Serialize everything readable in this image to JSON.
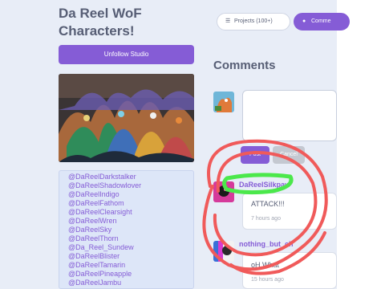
{
  "studio": {
    "title": "Da Reel WoF Characters!",
    "unfollow_label": "Unfollow Studio",
    "description_lines": [
      "@DaReelDarkstalker",
      "@DaReelShadowlover",
      "@DaReelIndigo",
      "@DaReelFathom",
      "@DaReelClearsight",
      "@DaReelWren",
      "@DaReelSky",
      "@DaReelThorn",
      "@Da_Reel_Sundew",
      "@DaReelBlister",
      "@DaReelTamarin",
      "@DaReelPineapple",
      "@DaReelJambu"
    ]
  },
  "tabs": {
    "projects_label": "Projects (100+)",
    "comments_label": "Comme"
  },
  "comments": {
    "heading": "Comments",
    "post_label": "Post",
    "cancel_label": "Cancel",
    "items": [
      {
        "author": "DaReelSilkpaw",
        "text": "ATTACK!!!",
        "time": "7 hours ago"
      },
      {
        "author": "nothing_but_ch",
        "text": "oH What",
        "time": "15 hours ago"
      }
    ]
  },
  "colors": {
    "accent": "#855cd6",
    "highlight_green": "#4be84b",
    "scribble_red": "#f05a5a"
  }
}
